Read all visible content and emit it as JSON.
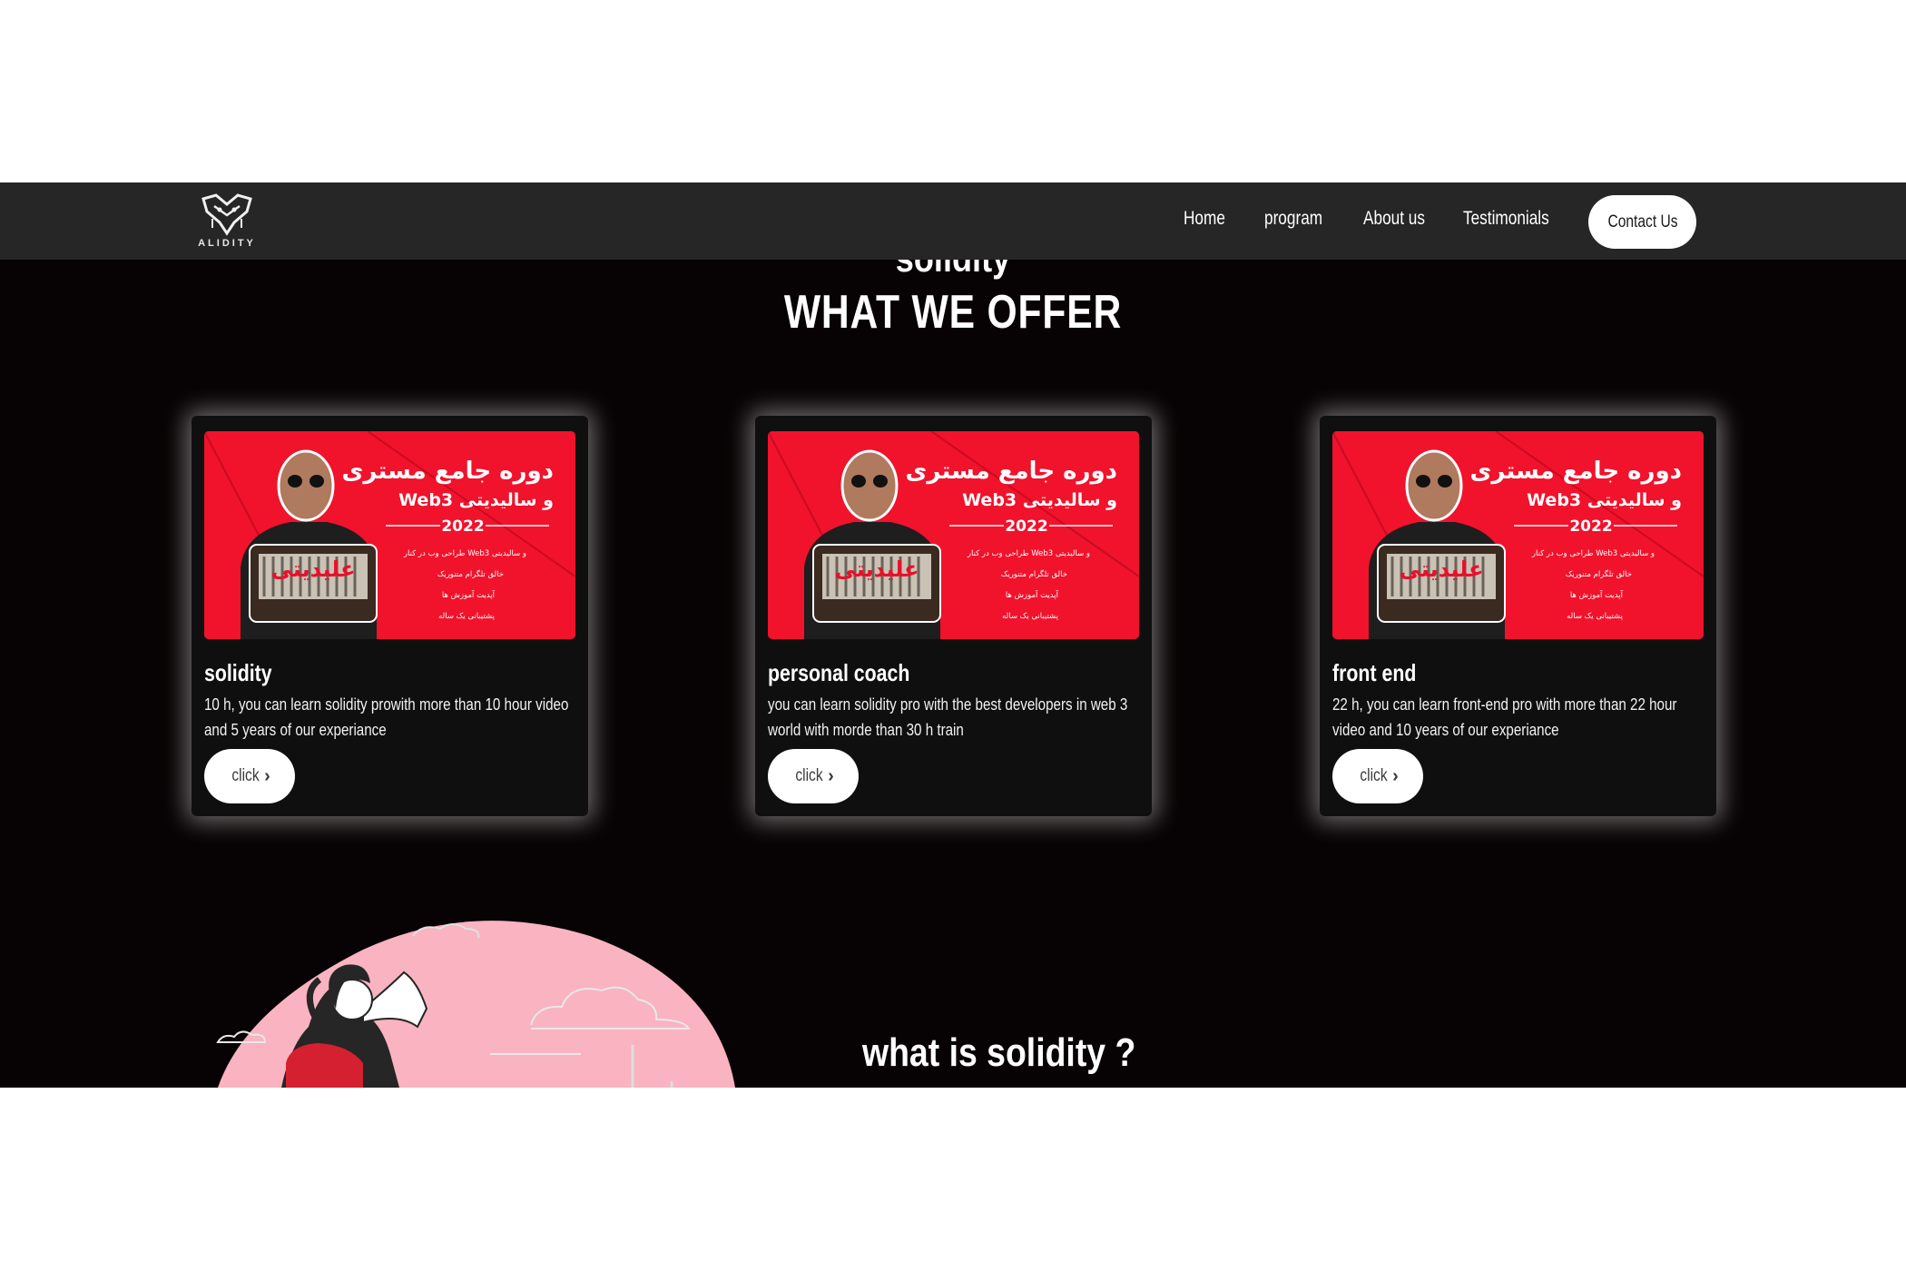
{
  "nav": {
    "logo_text": "ALIDITY",
    "links": [
      "Home",
      "program",
      "About us",
      "Testimonials"
    ],
    "contact": "Contact Us"
  },
  "section": {
    "cut_heading": "solidity",
    "title": "WHAT WE OFFER"
  },
  "cards": [
    {
      "title": "solidity",
      "desc": "10 h, you can learn solidity prowith more than 10 hour video and 5 years of our experiance",
      "button": "click"
    },
    {
      "title": "personal coach",
      "desc": "you can learn solidity pro with the best developers in web 3 world with morde than 30 h train",
      "button": "click"
    },
    {
      "title": "front end",
      "desc": "22 h, you can learn front-end pro with more than 22 hour video and 10 years of our experiance",
      "button": "click"
    }
  ],
  "course_image": {
    "title_line1": "دوره جامع مستری",
    "title_line2": "Web3 و سالیدیتی",
    "year": "2022",
    "bullets": [
      "طراحی وب در کنار Web3 و سالیدیتی",
      "خالق تلگرام متنوریک",
      "آپدیت آموزش ها",
      "پشتیبانی یک ساله"
    ],
    "badge": "علیدیتی"
  },
  "bottom": {
    "question": "what is solidity ?"
  },
  "colors": {
    "navbar": "#262626",
    "page_bg": "#070203",
    "card_bg": "#0f0f10",
    "image_red": "#f1122c",
    "blob_pink": "#f9b3c1"
  }
}
